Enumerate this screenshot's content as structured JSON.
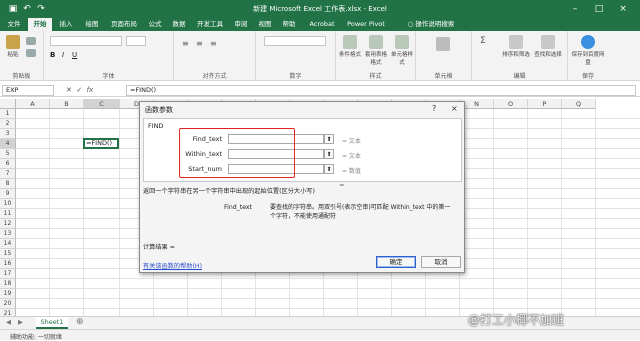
{
  "title_bar": {
    "title": "新建 Microsoft Excel 工作表.xlsx - Excel"
  },
  "tabs": [
    "文件",
    "开始",
    "插入",
    "绘图",
    "页面布局",
    "公式",
    "数据",
    "开发工具",
    "审阅",
    "视图",
    "帮助",
    "Acrobat",
    "Power Pivot"
  ],
  "tell_me": "操作说明搜索",
  "ribbon": {
    "paste": "粘贴",
    "clipboard": "剪贴板",
    "font": "字体",
    "alignment": "对齐方式",
    "number": "数字",
    "styles": "样式",
    "cells": "单元格",
    "editing": "编辑",
    "save": "保存到百度网盘",
    "cond_fmt": "条件格式",
    "table_fmt": "套用表格格式",
    "cell_style": "单元格样式",
    "sort": "排序和筛选",
    "find": "查找和选择",
    "save_group": "保存"
  },
  "formula_bar": {
    "name_box": "EXP",
    "fx": "fx",
    "formula": "=FIND()"
  },
  "columns": [
    "A",
    "B",
    "C",
    "D",
    "E",
    "F",
    "G",
    "H",
    "I",
    "J",
    "K",
    "L",
    "M",
    "N",
    "O",
    "P",
    "Q"
  ],
  "rows": [
    "1",
    "2",
    "3",
    "4",
    "5",
    "6",
    "7",
    "8",
    "9",
    "10",
    "11",
    "12",
    "13",
    "14",
    "15",
    "16",
    "17",
    "18",
    "19",
    "20",
    "21"
  ],
  "active_cell_value": "=FIND()",
  "dialog": {
    "title": "函数参数",
    "help_btn": "?",
    "close_btn": "×",
    "function_name": "FIND",
    "args": [
      {
        "label": "Find_text",
        "type": "= 文本"
      },
      {
        "label": "Within_text",
        "type": "= 文本"
      },
      {
        "label": "Start_num",
        "type": "= 数值"
      }
    ],
    "result_eq": "=",
    "description": "返回一个字符串在另一个字符串中出现的起始位置(区分大小写)",
    "param_name": "Find_text",
    "param_desc": "要查找的字符串。用双引号(表示空串)可匹配 Within_text 中的第一个字符，不能使用通配符",
    "calc_result": "计算结果 =",
    "help_link": "有关该函数的帮助(H)",
    "ok": "确定",
    "cancel": "取消"
  },
  "sheet_tab": "Sheet1",
  "status": "辅助功能: 一切就绪",
  "watermark": "@打工小椰不加班"
}
